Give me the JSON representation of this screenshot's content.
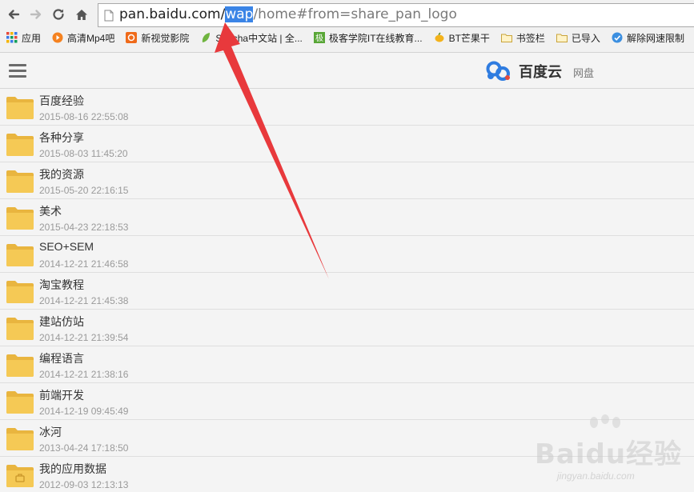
{
  "browser": {
    "url_prefix": "pan.baidu.com/",
    "url_highlight": "wap",
    "url_suffix": "/home#from=share_pan_logo"
  },
  "bookmarks": [
    {
      "label": "应用",
      "icon": "apps-grid-icon"
    },
    {
      "label": "高清Mp4吧",
      "icon": "play-circle-icon"
    },
    {
      "label": "新视觉影院",
      "icon": "movie-site-icon"
    },
    {
      "label": "Sencha中文站 | 全...",
      "icon": "leaf-icon"
    },
    {
      "label": "极客学院IT在线教育...",
      "icon": "jike-icon"
    },
    {
      "label": "BT芒果干",
      "icon": "mango-icon"
    },
    {
      "label": "书签栏",
      "icon": "folder-icon"
    },
    {
      "label": "已导入",
      "icon": "folder-icon"
    },
    {
      "label": "解除网速限制",
      "icon": "unlock-icon"
    }
  ],
  "header": {
    "logo_text": "百度云",
    "logo_sub": "网盘"
  },
  "files": [
    {
      "name": "百度经验",
      "date": "2015-08-16 22:55:08",
      "type": "folder"
    },
    {
      "name": "各种分享",
      "date": "2015-08-03 11:45:20",
      "type": "folder"
    },
    {
      "name": "我的资源",
      "date": "2015-05-20 22:16:15",
      "type": "folder"
    },
    {
      "name": "美术",
      "date": "2015-04-23 22:18:53",
      "type": "folder"
    },
    {
      "name": "SEO+SEM",
      "date": "2014-12-21 21:46:58",
      "type": "folder"
    },
    {
      "name": "淘宝教程",
      "date": "2014-12-21 21:45:38",
      "type": "folder"
    },
    {
      "name": "建站仿站",
      "date": "2014-12-21 21:39:54",
      "type": "folder"
    },
    {
      "name": "编程语言",
      "date": "2014-12-21 21:38:16",
      "type": "folder"
    },
    {
      "name": "前端开发",
      "date": "2014-12-19 09:45:49",
      "type": "folder"
    },
    {
      "name": "冰河",
      "date": "2013-04-24 17:18:50",
      "type": "folder"
    },
    {
      "name": "我的应用数据",
      "date": "2012-09-03 12:13:13",
      "type": "app-folder"
    }
  ],
  "watermark": {
    "text": "Baidu经验",
    "url": "jingyan.baidu.com"
  },
  "colors": {
    "folder": "#f2c14e",
    "arrow": "#e8393c",
    "url_highlight": "#3a84e6"
  }
}
